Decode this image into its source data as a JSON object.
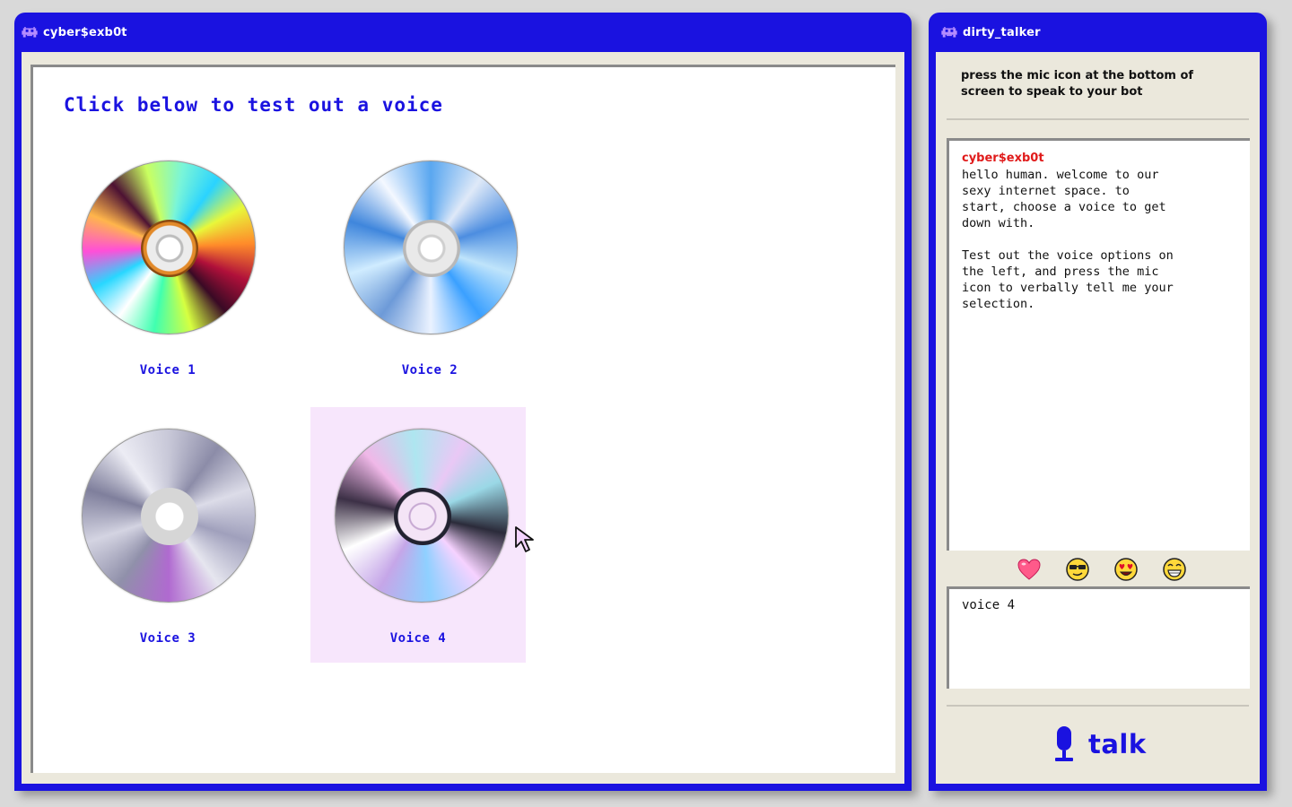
{
  "left_window": {
    "title": "cyber$exb0t",
    "heading": "Click below to test out a voice",
    "voices": [
      {
        "label": "Voice 1"
      },
      {
        "label": "Voice 2"
      },
      {
        "label": "Voice 3"
      },
      {
        "label": "Voice 4"
      }
    ]
  },
  "right_window": {
    "title": "dirty_talker",
    "instruction": "press the mic icon at the bottom of screen to speak to your bot",
    "chat": {
      "bot_name": "cyber$exb0t",
      "message": "hello human. welcome to our\nsexy internet space. to\nstart, choose a voice to get\ndown with.\n\nTest out the voice options on\nthe left, and press the mic\nicon to verbally tell me your\nselection."
    },
    "emojis": [
      "heart-icon",
      "cool-face-icon",
      "heart-eyes-face-icon",
      "grin-face-icon"
    ],
    "input_value": "voice 4",
    "talk_label": "talk"
  },
  "colors": {
    "accent_blue": "#1a12e0",
    "bot_red": "#e01a1a",
    "panel_beige": "#ebe8dc",
    "selected_pink": "#f7e6fc"
  }
}
